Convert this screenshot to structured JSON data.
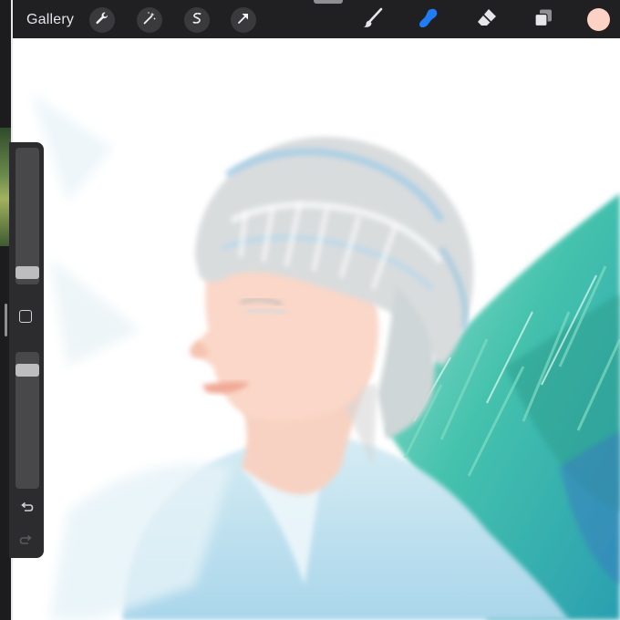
{
  "toolbar": {
    "gallery_label": "Gallery",
    "actions": [
      "wrench-icon",
      "magic-wand-icon",
      "selection-s-icon",
      "transform-arrow-icon"
    ],
    "tools": [
      "brush-icon",
      "smudge-icon",
      "eraser-icon",
      "layers-icon"
    ],
    "active_tool": "smudge-icon",
    "accent_color": "#1f7cf5",
    "current_color": "#fbd2c4"
  },
  "sidebar": {
    "items": [
      "brush-size-slider",
      "modify-button",
      "opacity-slider",
      "undo-icon",
      "redo-icon"
    ]
  },
  "canvas": {
    "content": "painting"
  }
}
